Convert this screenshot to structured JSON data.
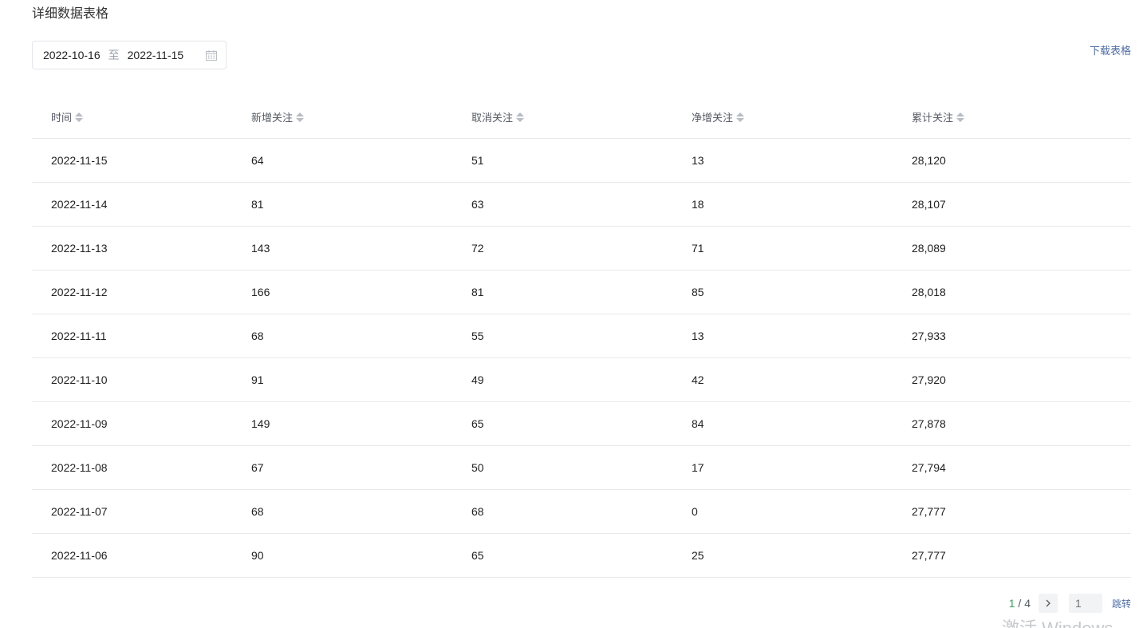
{
  "section_title": "详细数据表格",
  "date_range": {
    "start": "2022-10-16",
    "separator": "至",
    "end": "2022-11-15",
    "icon": "calendar-icon"
  },
  "download_label": "下载表格",
  "table": {
    "headers": [
      "时间",
      "新增关注",
      "取消关注",
      "净增关注",
      "累计关注"
    ],
    "rows": [
      [
        "2022-11-15",
        "64",
        "51",
        "13",
        "28,120"
      ],
      [
        "2022-11-14",
        "81",
        "63",
        "18",
        "28,107"
      ],
      [
        "2022-11-13",
        "143",
        "72",
        "71",
        "28,089"
      ],
      [
        "2022-11-12",
        "166",
        "81",
        "85",
        "28,018"
      ],
      [
        "2022-11-11",
        "68",
        "55",
        "13",
        "27,933"
      ],
      [
        "2022-11-10",
        "91",
        "49",
        "42",
        "27,920"
      ],
      [
        "2022-11-09",
        "149",
        "65",
        "84",
        "27,878"
      ],
      [
        "2022-11-08",
        "67",
        "50",
        "17",
        "27,794"
      ],
      [
        "2022-11-07",
        "68",
        "68",
        "0",
        "27,777"
      ],
      [
        "2022-11-06",
        "90",
        "65",
        "25",
        "27,777"
      ]
    ]
  },
  "pagination": {
    "current": "1",
    "separator": " / ",
    "total": "4",
    "next_icon": "chevron-right-icon",
    "input_placeholder": "1",
    "jump_label": "跳转"
  },
  "watermark": "激活 Windows",
  "colors": {
    "accent_link": "#4e6ea6",
    "current_page": "#3aa05c",
    "border": "#e8e9ec"
  }
}
